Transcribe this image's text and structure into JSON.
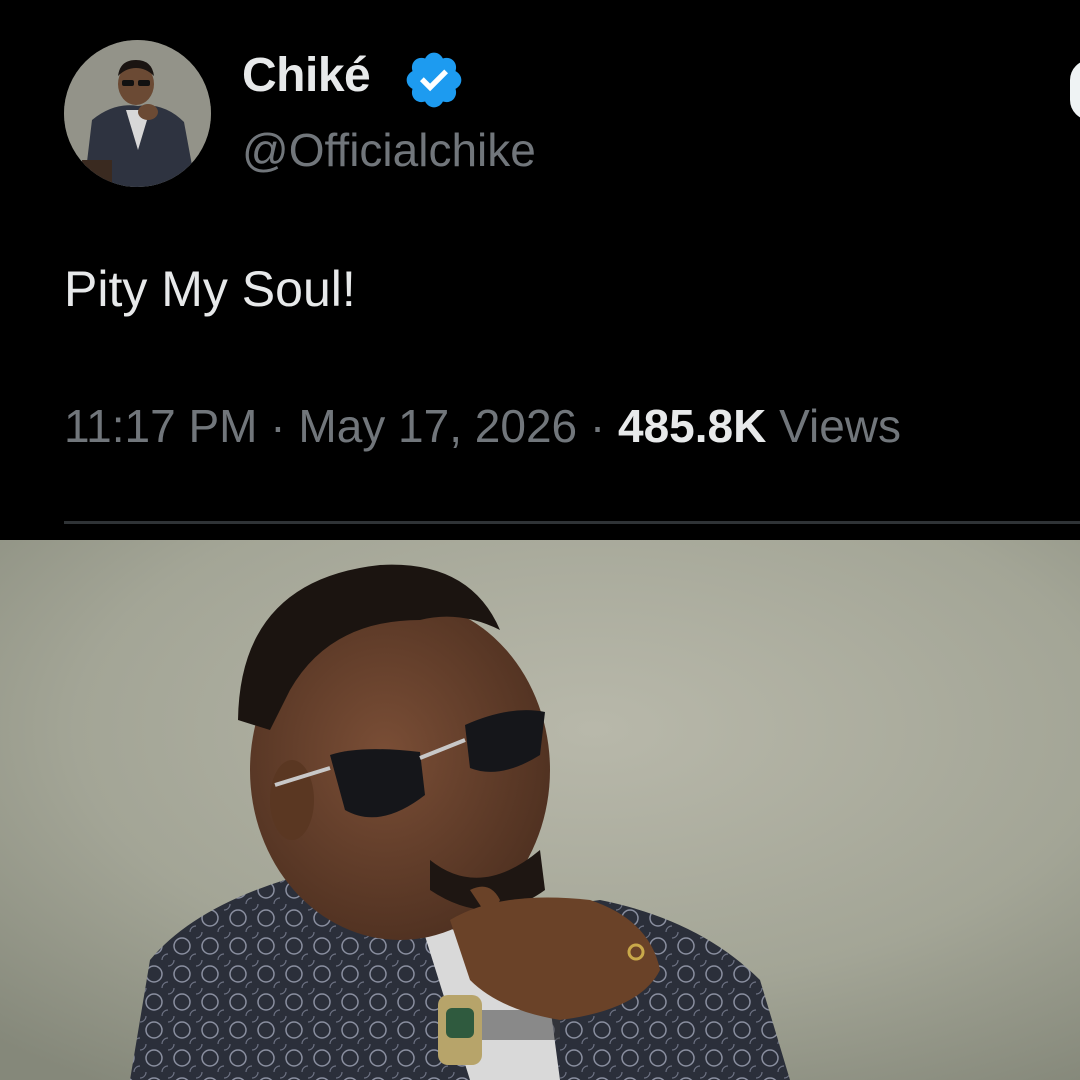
{
  "tweet": {
    "display_name": "Chiké",
    "handle": "@Officialchike",
    "text": "Pity My Soul!",
    "time": "11:17 PM",
    "separator": "·",
    "date": "May 17, 2026",
    "views_count": "485.8K",
    "views_label": "Views"
  },
  "icons": {
    "verified": "verified-badge-icon",
    "avatar": "profile-photo",
    "media": "attached-photo"
  },
  "colors": {
    "background": "#000000",
    "primary_text": "#e7e9ea",
    "secondary_text": "#71767b",
    "verified_blue": "#1d9bf0",
    "divider": "#2f3336"
  }
}
